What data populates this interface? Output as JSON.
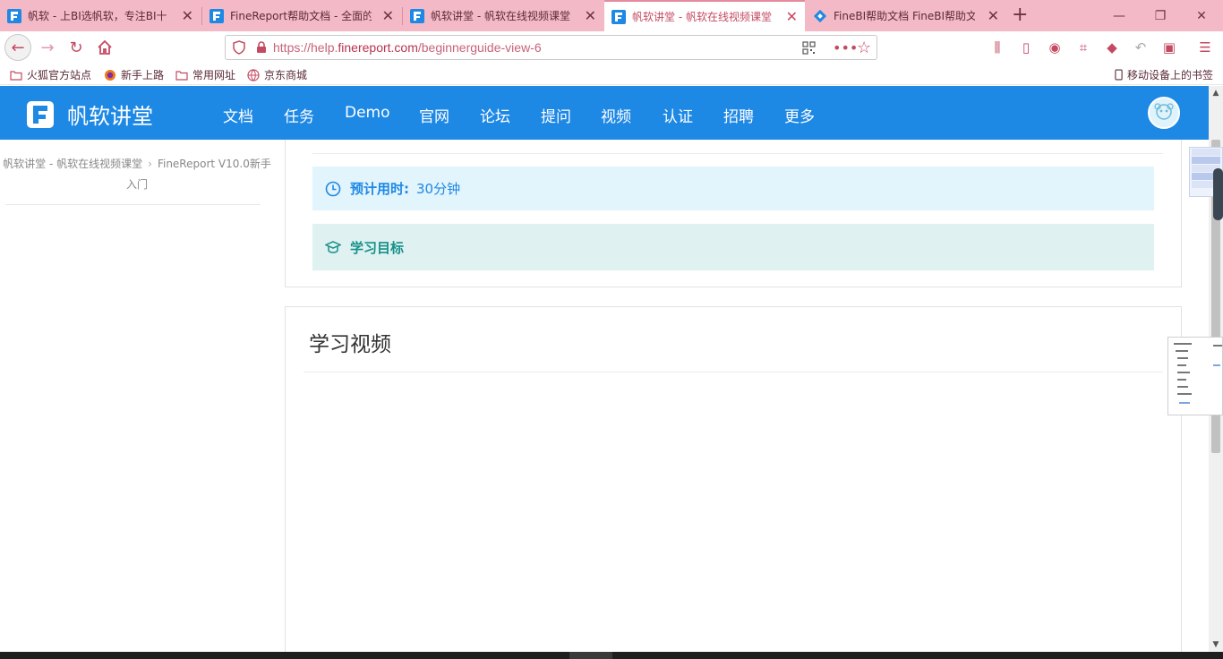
{
  "tabs": [
    {
      "label": "帆软 - 上BI选帆软，专注BI十",
      "active": false
    },
    {
      "label": "FineReport帮助文档 - 全面的",
      "active": false
    },
    {
      "label": "帆软讲堂 - 帆软在线视频课堂",
      "active": false
    },
    {
      "label": "帆软讲堂 - 帆软在线视频课堂",
      "active": true
    },
    {
      "label": "FineBI帮助文档 FineBI帮助文",
      "active": false
    }
  ],
  "address": {
    "prefix": "https://help.",
    "domain": "finereport.com",
    "path": "/beginnerguide-view-6"
  },
  "bookmarks": [
    {
      "label": "火狐官方站点"
    },
    {
      "label": "新手上路"
    },
    {
      "label": "常用网址"
    },
    {
      "label": "京东商城"
    }
  ],
  "mobile_bookmarks": "移动设备上的书签",
  "site": {
    "brand": "帆软讲堂",
    "menu": [
      "文档",
      "任务",
      "Demo",
      "官网",
      "论坛",
      "提问",
      "视频",
      "认证",
      "招聘",
      "更多"
    ]
  },
  "breadcrumb": {
    "item1": "帆软讲堂 - 帆软在线视频课堂",
    "item2": "FineReport V10.0新手入门"
  },
  "lesson": {
    "time_label": "预计用时:",
    "time_value": "30分钟",
    "goal_label": "学习目标",
    "video_title": "学习视频"
  },
  "colors": {
    "brand_blue": "#1e88e5",
    "tab_bar_pink": "#f4b9c6",
    "goal_teal": "#16908a"
  }
}
